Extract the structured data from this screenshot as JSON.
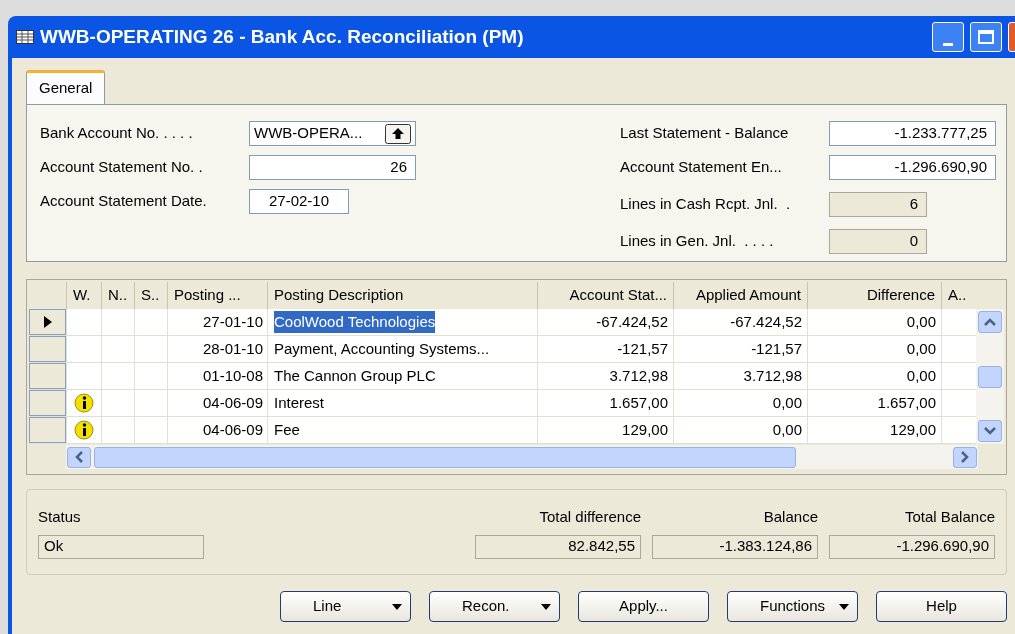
{
  "window": {
    "title": "WWB-OPERATING 26 - Bank Acc. Reconciliation (PM)"
  },
  "tabs": [
    {
      "label": "General",
      "selected": true
    }
  ],
  "general_left": [
    {
      "label": "Bank Account No. . . . .",
      "value": "WWB-OPERA...",
      "kind": "lookup"
    },
    {
      "label": "Account Statement No. .",
      "value": "26",
      "kind": "number"
    },
    {
      "label": "Account Statement Date.",
      "value": "27-02-10",
      "kind": "date"
    }
  ],
  "general_right": [
    {
      "label": "Last Statement - Balance",
      "value": "-1.233.777,25",
      "kind": "input"
    },
    {
      "label": "Account Statement En...",
      "value": "-1.296.690,90",
      "kind": "input"
    },
    {
      "label": "Lines in Cash Rcpt. Jnl.  .",
      "value": "6",
      "kind": "readonly"
    },
    {
      "label": "Lines in Gen. Jnl.  . . . .",
      "value": "0",
      "kind": "readonly"
    }
  ],
  "table": {
    "columns": [
      "W.",
      "N..",
      "S..",
      "Posting ...",
      "Posting Description",
      "Account Stat...",
      "Applied Amount",
      "Difference",
      "A.."
    ],
    "rows": [
      {
        "current": true,
        "info": false,
        "selected_description": true,
        "posting_date": "27-01-10",
        "description": "CoolWood Technologies",
        "account_statement": "-67.424,52",
        "applied_amount": "-67.424,52",
        "difference": "0,00"
      },
      {
        "current": false,
        "info": false,
        "selected_description": false,
        "posting_date": "28-01-10",
        "description": "Payment, Accounting Systems...",
        "account_statement": "-121,57",
        "applied_amount": "-121,57",
        "difference": "0,00"
      },
      {
        "current": false,
        "info": false,
        "selected_description": false,
        "posting_date": "01-10-08",
        "description": "The Cannon Group PLC",
        "account_statement": "3.712,98",
        "applied_amount": "3.712,98",
        "difference": "0,00"
      },
      {
        "current": false,
        "info": true,
        "selected_description": false,
        "posting_date": "04-06-09",
        "description": "Interest",
        "account_statement": "1.657,00",
        "applied_amount": "0,00",
        "difference": "1.657,00"
      },
      {
        "current": false,
        "info": true,
        "selected_description": false,
        "posting_date": "04-06-09",
        "description": "Fee",
        "account_statement": "129,00",
        "applied_amount": "0,00",
        "difference": "129,00"
      }
    ]
  },
  "totals": [
    {
      "label": "Status",
      "value": "Ok",
      "kind": "text"
    },
    {
      "label": "Total difference",
      "value": "82.842,55",
      "kind": "amount"
    },
    {
      "label": "Balance",
      "value": "-1.383.124,86",
      "kind": "amount"
    },
    {
      "label": "Total Balance",
      "value": "-1.296.690,90",
      "kind": "amount"
    }
  ],
  "buttons": [
    {
      "label": "Line",
      "dropdown": true
    },
    {
      "label": "Recon.",
      "dropdown": true
    },
    {
      "label": "Apply...",
      "dropdown": false
    },
    {
      "label": "Functions",
      "dropdown": true
    },
    {
      "label": "Help",
      "dropdown": false
    }
  ]
}
